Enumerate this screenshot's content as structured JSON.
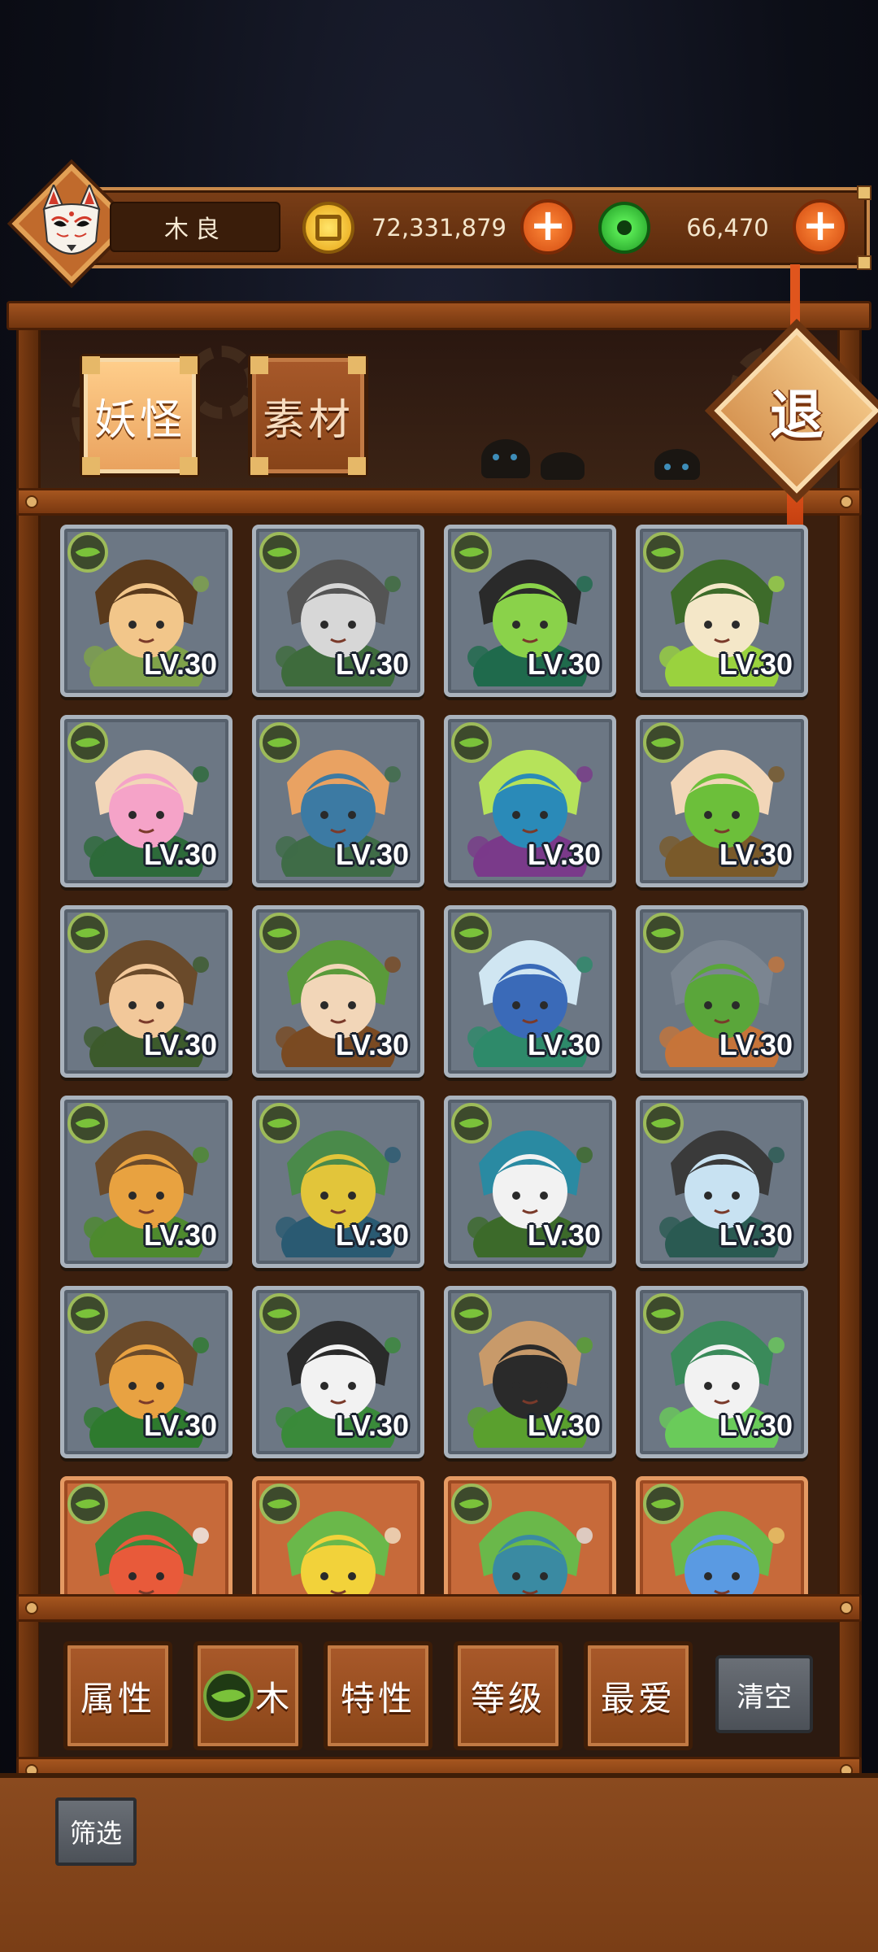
{
  "player": {
    "name": "木良",
    "gold": "72,331,879",
    "jade": "66,470"
  },
  "hud": {
    "gold_add": "+",
    "jade_add": "+"
  },
  "tabs": [
    {
      "label": "妖怪",
      "active": true
    },
    {
      "label": "素材",
      "active": false
    }
  ],
  "exit_label": "退",
  "collection": [
    {
      "level": "LV.30",
      "element": "wood",
      "frame": "normal",
      "palette": [
        "#7fa24a",
        "#f2c68a",
        "#5a3a1c"
      ]
    },
    {
      "level": "LV.30",
      "element": "wood",
      "frame": "normal",
      "palette": [
        "#3e6b3c",
        "#d7d7d7",
        "#545454"
      ]
    },
    {
      "level": "LV.30",
      "element": "wood",
      "frame": "normal",
      "palette": [
        "#1f6a4c",
        "#8ad24a",
        "#2a2a2a"
      ]
    },
    {
      "level": "LV.30",
      "element": "wood",
      "frame": "normal",
      "palette": [
        "#9ad23e",
        "#f4e7c8",
        "#3d6b2a"
      ]
    },
    {
      "level": "LV.30",
      "element": "wood",
      "frame": "normal",
      "palette": [
        "#2d6a3a",
        "#f5a3c8",
        "#f2d6b8"
      ]
    },
    {
      "level": "LV.30",
      "element": "wood",
      "frame": "normal",
      "palette": [
        "#3f6c47",
        "#3c7aa3",
        "#e9a262"
      ]
    },
    {
      "level": "LV.30",
      "element": "wood",
      "frame": "normal",
      "palette": [
        "#7a3a8a",
        "#2a8ab8",
        "#b6e35a"
      ]
    },
    {
      "level": "LV.30",
      "element": "wood",
      "frame": "normal",
      "palette": [
        "#7a5a2a",
        "#6cbf3a",
        "#f2d6b8"
      ]
    },
    {
      "level": "LV.30",
      "element": "wood",
      "frame": "normal",
      "palette": [
        "#3c5a2c",
        "#f2c89a",
        "#6a4a2a"
      ]
    },
    {
      "level": "LV.30",
      "element": "wood",
      "frame": "normal",
      "palette": [
        "#7a4a22",
        "#f2d6b8",
        "#5a9a3a"
      ]
    },
    {
      "level": "LV.30",
      "element": "wood",
      "frame": "normal",
      "palette": [
        "#2e8a6a",
        "#3a6ab8",
        "#d0e6f2"
      ]
    },
    {
      "level": "LV.30",
      "element": "wood",
      "frame": "normal",
      "palette": [
        "#c6743a",
        "#5aa63a",
        "#7b8591"
      ]
    },
    {
      "level": "LV.30",
      "element": "wood",
      "frame": "normal",
      "palette": [
        "#4e8a2e",
        "#e8a240",
        "#6a4a2a"
      ]
    },
    {
      "level": "LV.30",
      "element": "wood",
      "frame": "normal",
      "palette": [
        "#2a5a72",
        "#e2c53a",
        "#4a8a4a"
      ]
    },
    {
      "level": "LV.30",
      "element": "wood",
      "frame": "normal",
      "palette": [
        "#3c6a2a",
        "#f2f2f2",
        "#2a8aa2"
      ]
    },
    {
      "level": "LV.30",
      "element": "wood",
      "frame": "normal",
      "palette": [
        "#2a5a52",
        "#c8e2f2",
        "#3a3a3a"
      ]
    },
    {
      "level": "LV.30",
      "element": "wood",
      "frame": "normal",
      "palette": [
        "#2e7a2e",
        "#e8a242",
        "#6a4a2a"
      ]
    },
    {
      "level": "LV.30",
      "element": "wood",
      "frame": "normal",
      "palette": [
        "#3a8a3a",
        "#f2f2f2",
        "#2a2a2a"
      ]
    },
    {
      "level": "LV.30",
      "element": "wood",
      "frame": "normal",
      "palette": [
        "#5aa02e",
        "#2a2a2a",
        "#c89a6a"
      ]
    },
    {
      "level": "LV.30",
      "element": "wood",
      "frame": "normal",
      "palette": [
        "#6acb5a",
        "#f2f2f2",
        "#3a8a5a"
      ]
    },
    {
      "level": "",
      "element": "wood",
      "frame": "rare",
      "palette": [
        "#f2f2f2",
        "#e85a3a",
        "#3a8a3a"
      ]
    },
    {
      "level": "",
      "element": "wood",
      "frame": "rare",
      "palette": [
        "#f2e2c8",
        "#f2d23a",
        "#6ab84a"
      ]
    },
    {
      "level": "",
      "element": "wood",
      "frame": "rare",
      "palette": [
        "#e2e2e2",
        "#3a8aa2",
        "#6ab84a"
      ]
    },
    {
      "level": "",
      "element": "wood",
      "frame": "rare",
      "palette": [
        "#e8c86a",
        "#5a9ae2",
        "#6ab84a"
      ]
    }
  ],
  "filters": {
    "attribute": "属性",
    "element": "木",
    "trait": "特性",
    "level": "等级",
    "favorite": "最爱",
    "clear": "清空",
    "screen": "筛选"
  }
}
